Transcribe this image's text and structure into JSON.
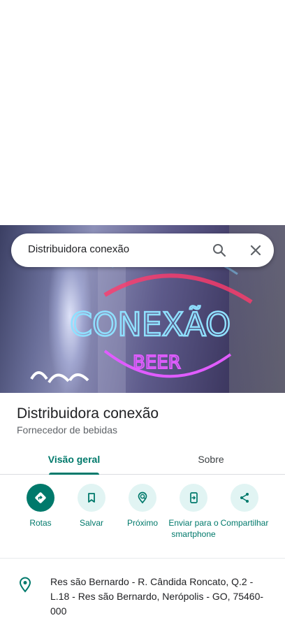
{
  "search": {
    "query": "Distribuidora conexão",
    "icons": {
      "search": "search-icon",
      "clear": "close-icon"
    }
  },
  "hero": {
    "sign_main": "CONEXÃO",
    "sign_sub": "BEER",
    "colors": {
      "neon_blue": "#7fd4ff",
      "neon_pink": "#e05cff",
      "neon_red": "#ff3b6b"
    }
  },
  "place": {
    "title": "Distribuidora conexão",
    "category": "Fornecedor de bebidas"
  },
  "tabs": [
    {
      "label": "Visão geral",
      "active": true
    },
    {
      "label": "Sobre",
      "active": false
    }
  ],
  "actions": [
    {
      "label": "Rotas",
      "icon": "directions-icon"
    },
    {
      "label": "Salvar",
      "icon": "bookmark-icon"
    },
    {
      "label": "Próximo",
      "icon": "nearby-icon"
    },
    {
      "label": "Enviar para o smartphone",
      "icon": "send-to-phone-icon"
    },
    {
      "label": "Compartilhar",
      "icon": "share-icon"
    }
  ],
  "address": {
    "text": "Res são Bernardo - R. Cândida Roncato, Q.2 - L.18 - Res são Bernardo, Nerópolis - GO, 75460-000",
    "icon": "location-pin-icon"
  },
  "theme": {
    "accent": "#00796b",
    "accent_light": "#e1f4f3",
    "text": "#202124",
    "secondary_text": "#5f6368"
  }
}
